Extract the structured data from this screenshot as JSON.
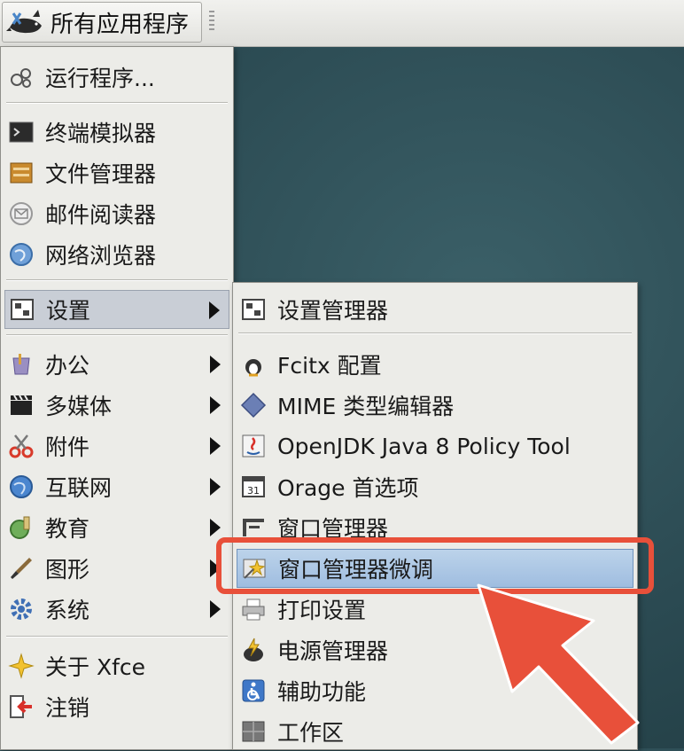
{
  "topbar": {
    "apps_label": "所有应用程序"
  },
  "main_menu": {
    "items": [
      {
        "label": "运行程序...",
        "icon": "run-program-icon"
      },
      {
        "label": "终端模拟器",
        "icon": "terminal-icon"
      },
      {
        "label": "文件管理器",
        "icon": "file-manager-icon"
      },
      {
        "label": "邮件阅读器",
        "icon": "mail-icon"
      },
      {
        "label": "网络浏览器",
        "icon": "web-browser-icon"
      },
      {
        "label": "设置",
        "icon": "settings-icon",
        "submenu": true,
        "active": true
      },
      {
        "label": "办公",
        "icon": "office-icon",
        "submenu": true
      },
      {
        "label": "多媒体",
        "icon": "multimedia-icon",
        "submenu": true
      },
      {
        "label": "附件",
        "icon": "accessories-icon",
        "submenu": true
      },
      {
        "label": "互联网",
        "icon": "internet-icon",
        "submenu": true
      },
      {
        "label": "教育",
        "icon": "education-icon",
        "submenu": true
      },
      {
        "label": "图形",
        "icon": "graphics-icon",
        "submenu": true
      },
      {
        "label": "系统",
        "icon": "system-icon",
        "submenu": true
      },
      {
        "label": "关于 Xfce",
        "icon": "about-icon"
      },
      {
        "label": "注销",
        "icon": "logout-icon"
      }
    ]
  },
  "sub_menu": {
    "items": [
      {
        "label": "设置管理器",
        "icon": "settings-manager-icon"
      },
      {
        "label": "Fcitx 配置",
        "icon": "fcitx-icon"
      },
      {
        "label": "MIME 类型编辑器",
        "icon": "mime-editor-icon"
      },
      {
        "label": "OpenJDK Java 8 Policy Tool",
        "icon": "java-policy-icon"
      },
      {
        "label": "Orage 首选项",
        "icon": "calendar-icon"
      },
      {
        "label": "窗口管理器",
        "icon": "window-manager-icon"
      },
      {
        "label": "窗口管理器微调",
        "icon": "window-tweaks-icon",
        "selected": true
      },
      {
        "label": "打印设置",
        "icon": "printer-icon"
      },
      {
        "label": "电源管理器",
        "icon": "power-manager-icon"
      },
      {
        "label": "辅助功能",
        "icon": "accessibility-icon"
      },
      {
        "label": "工作区",
        "icon": "workspace-icon"
      }
    ]
  },
  "colors": {
    "highlight": "#e8503a",
    "selection": "#a9c4e3",
    "menu_bg": "#ecece8"
  }
}
